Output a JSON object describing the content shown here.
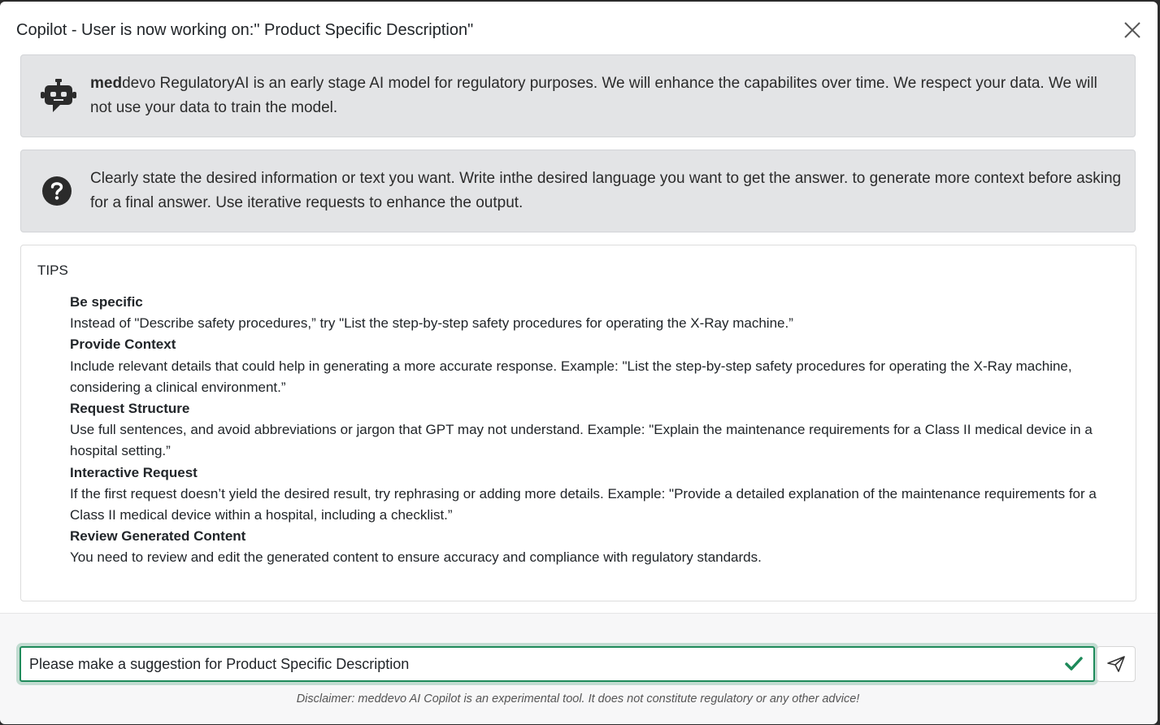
{
  "modal": {
    "title": "Copilot - User is now working on:\" Product Specific Description\""
  },
  "ai_notice": {
    "icon": "robot-icon",
    "brand_bold": "med",
    "brand_rest": "devo",
    "text": " RegulatoryAI is an early stage AI model for regulatory purposes. We will enhance the capabilites over time. We respect your data. We will not use your data to train the model."
  },
  "help_notice": {
    "icon": "question-circle-icon",
    "text": "Clearly state the desired information or text you want. Write inthe desired language you want to get the answer. to generate more context before asking for a final answer. Use iterative requests to enhance the output."
  },
  "tips": {
    "title": "TIPS",
    "items": [
      {
        "heading": "Be specific",
        "body": "Instead of \"Describe safety procedures,” try \"List the step-by-step safety procedures for operating the X-Ray machine.”"
      },
      {
        "heading": "Provide Context",
        "body": "Include relevant details that could help in generating a more accurate response. Example: \"List the step-by-step safety procedures for operating the X-Ray machine, considering a clinical environment.”"
      },
      {
        "heading": "Request Structure",
        "body": "Use full sentences, and avoid abbreviations or jargon that GPT may not understand. Example: \"Explain the maintenance requirements for a Class II medical device in a hospital setting.”"
      },
      {
        "heading": "Interactive Request",
        "body": "If the first request doesn’t yield the desired result, try rephrasing or adding more details. Example: \"Provide a detailed explanation of the maintenance requirements for a Class II medical device within a hospital, including a checklist.”"
      },
      {
        "heading": "Review Generated Content",
        "body": "You need to review and edit the generated content to ensure accuracy and compliance with regulatory standards."
      }
    ]
  },
  "prompt": {
    "value": "Please make a suggestion for Product Specific Description",
    "valid_icon": "check-icon",
    "send_icon": "send-icon"
  },
  "disclaimer": "Disclaimer: meddevo AI Copilot is an experimental tool. It does not constitute regulatory or any other advice!",
  "colors": {
    "accent": "#1e8a5a",
    "notice_bg": "#e3e4e6"
  }
}
